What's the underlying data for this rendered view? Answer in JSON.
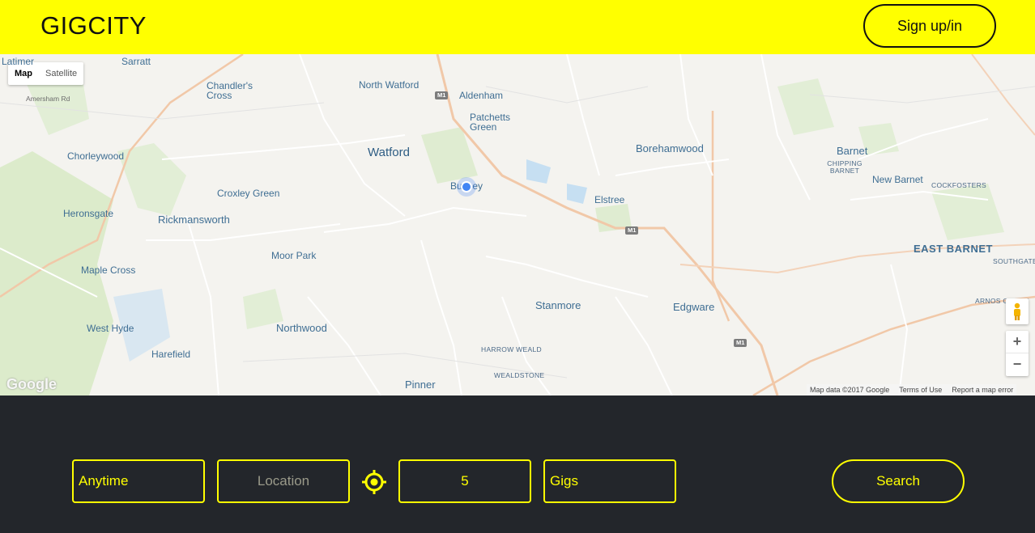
{
  "header": {
    "logo": "GIGCITY",
    "signup_label": "Sign up/in"
  },
  "map": {
    "map_type_options": [
      "Map",
      "Satellite"
    ],
    "active_map_type": "Map",
    "places_big": [
      "Watford",
      "Borehamwood",
      "Barnet",
      "EAST BARNET",
      "Edgware",
      "Stanmore",
      "Rickmansworth",
      "Northwood",
      "Chorleywood",
      "Pinner"
    ],
    "places": [
      "Latimer",
      "Sarratt",
      "Chandler's Cross",
      "North Watford",
      "Aldenham",
      "Patchetts Green",
      "Bushey",
      "Elstree",
      "Croxley Green",
      "Heronsgate",
      "Moor Park",
      "Maple Cross",
      "West Hyde",
      "Harefield",
      "New Barnet",
      "Amersham Rd"
    ],
    "places_small": [
      "CHIPPING BARNET",
      "COCKFOSTERS",
      "SOUTHGATE",
      "ARNOS GROVE",
      "HARROW WEALD",
      "WEALDSTONE"
    ],
    "zoom_in": "+",
    "zoom_out": "−",
    "logo_text": "Google",
    "footer": {
      "data": "Map data ©2017 Google",
      "terms": "Terms of Use",
      "report": "Report a map error"
    }
  },
  "search_bar": {
    "time_value": "Anytime",
    "location_placeholder": "Location",
    "radius_value": "5",
    "type_value": "Gigs",
    "search_label": "Search"
  },
  "colors": {
    "brand": "#ffff00",
    "dark": "#23262b"
  }
}
